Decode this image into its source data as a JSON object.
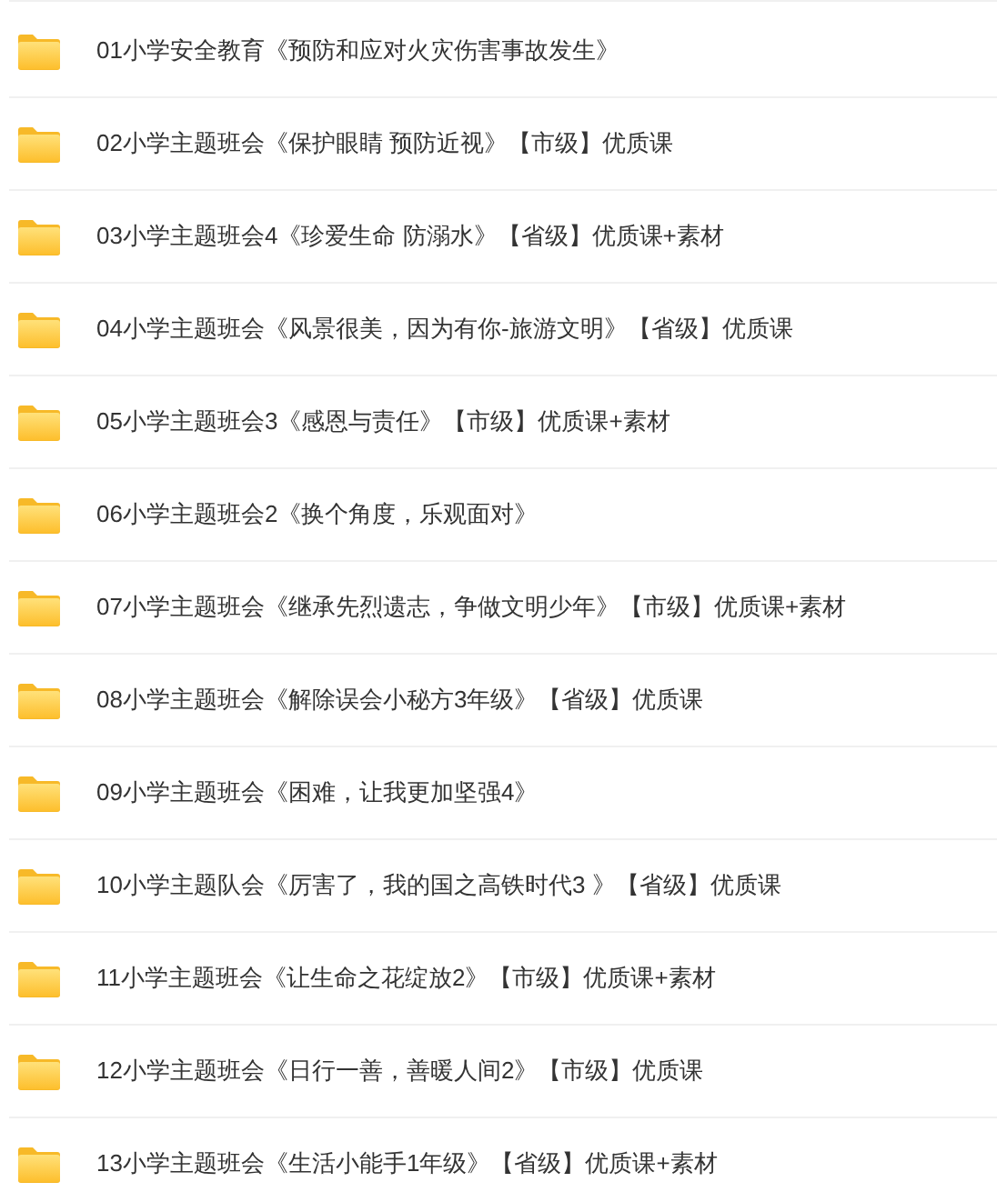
{
  "folders": [
    {
      "name": "01小学安全教育《预防和应对火灾伤害事故发生》"
    },
    {
      "name": "02小学主题班会《保护眼睛 预防近视》【市级】优质课"
    },
    {
      "name": "03小学主题班会4《珍爱生命 防溺水》【省级】优质课+素材"
    },
    {
      "name": "04小学主题班会《风景很美，因为有你-旅游文明》【省级】优质课"
    },
    {
      "name": "05小学主题班会3《感恩与责任》【市级】优质课+素材"
    },
    {
      "name": "06小学主题班会2《换个角度，乐观面对》"
    },
    {
      "name": "07小学主题班会《继承先烈遗志，争做文明少年》【市级】优质课+素材"
    },
    {
      "name": "08小学主题班会《解除误会小秘方3年级》【省级】优质课"
    },
    {
      "name": "09小学主题班会《困难，让我更加坚强4》"
    },
    {
      "name": "10小学主题队会《厉害了，我的国之高铁时代3 》【省级】优质课"
    },
    {
      "name": "11小学主题班会《让生命之花绽放2》【市级】优质课+素材"
    },
    {
      "name": "12小学主题班会《日行一善，善暖人间2》【市级】优质课"
    },
    {
      "name": "13小学主题班会《生活小能手1年级》【省级】优质课+素材"
    }
  ]
}
